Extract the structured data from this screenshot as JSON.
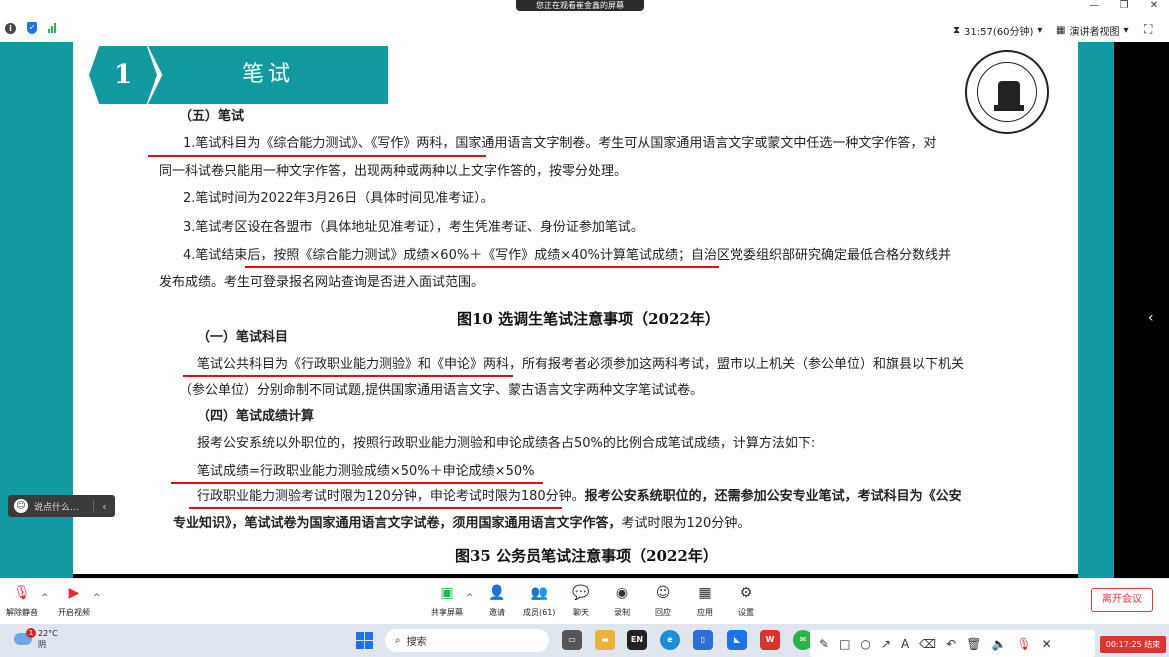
{
  "top_bar": {
    "banner": "您正在观看崔金鑫的屏幕",
    "timer": "31:57(60分钟)",
    "view_mode": "演讲者视图"
  },
  "slide": {
    "section_number": "1",
    "section_title": "笔试",
    "block1": {
      "heading": "（五）笔试",
      "line1": "1.笔试科目为《综合能力测试》、《写作》两科，国家通用语言文字制卷。考生可从国家通用语言文字或蒙文中任选一种文字作答，对",
      "line2": "同一科试卷只能用一种文字作答，出现两种或两种以上文字作答的，按零分处理。",
      "line3": "2.笔试时间为2022年3月26日（具体时间见准考证）。",
      "line4": "3.笔试考区设在各盟市（具体地址见准考证），考生凭准考证、身份证参加笔试。",
      "line5": "4.笔试结束后，按照《综合能力测试》成绩×60%＋《写作》成绩×40%计算笔试成绩；自治区党委组织部研究确定最低合格分数线并",
      "line6": "发布成绩。考生可登录报名网站查询是否进入面试范围。"
    },
    "caption1": "图10 选调生笔试注意事项（2022年）",
    "block2": {
      "heading1": "（一）笔试科目",
      "line1": "笔试公共科目为《行政职业能力测验》和《申论》两科，所有报考者必须参加这两科考试，盟市以上机关（参公单位）和旗县以下机关",
      "line2": "（参公单位）分别命制不同试题,提供国家通用语言文字、蒙古语言文字两种文字笔试试卷。",
      "heading2": "（四）笔试成绩计算",
      "line3": "报考公安系统以外职位的，按照行政职业能力测验和申论成绩各占50%的比例合成笔试成绩，计算方法如下:",
      "line4": "笔试成绩=行政职业能力测验成绩×50%＋申论成绩×50%",
      "line5a": "行政职业能力测验考试时限为120分钟，申论考试时限为180分钟。",
      "line5b": "报考公安系统职位的，还需参加公安专业笔试，考试科目为《公安",
      "line6a": "专业知识》，笔试试卷为国家通用语言文字试卷，须用国家通用语言文字作答，",
      "line6b": "考试时限为120分钟。"
    },
    "caption2": "图35 公务员笔试注意事项（2022年）"
  },
  "chat": {
    "placeholder": "说点什么..."
  },
  "toolbar": {
    "unmute": "解除静音",
    "start_video": "开启视频",
    "share_screen": "共享屏幕",
    "invite": "邀请",
    "members": "成员(61)",
    "chat": "聊天",
    "record": "录制",
    "reactions": "回应",
    "apps": "应用",
    "settings": "设置",
    "leave": "离开会议"
  },
  "taskbar": {
    "weather_temp": "22°C",
    "weather_desc": "阴",
    "weather_badge": "1",
    "search_label": "搜索",
    "lang": "EN",
    "clock": "00:17:25 结束"
  }
}
